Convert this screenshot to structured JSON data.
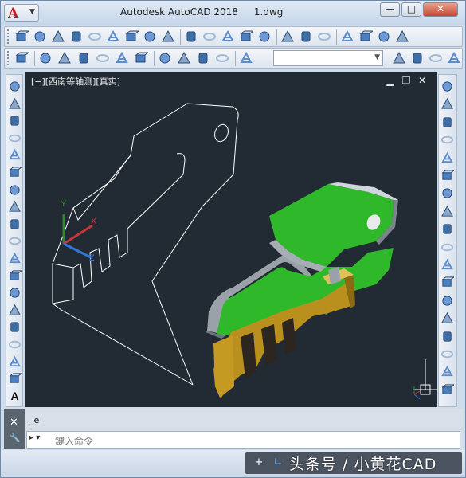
{
  "titlebar": {
    "app_name": "Autodesk AutoCAD 2018",
    "file_name": "1.dwg",
    "app_logo": "A",
    "app_menu_caret": "▼",
    "minimize": "—",
    "maximize": "□",
    "close": "✕"
  },
  "toolbar_modeling": {
    "icons": [
      "polysolid-icon",
      "box-icon",
      "wedge-icon",
      "cone-icon",
      "sphere-icon",
      "cylinder-icon",
      "torus-icon",
      "pyramid-icon",
      "planar-surface-icon",
      "extrude-icon",
      "presspull-icon",
      "sweep-icon",
      "revolve-icon",
      "loft-icon",
      "union-icon",
      "subtract-icon",
      "intersect-icon",
      "move-gizmo-icon",
      "rotate-gizmo-icon",
      "3d-align-icon",
      "3d-array-icon"
    ]
  },
  "toolbar_visual": {
    "icons": [
      "layer-manager-icon",
      "2d-wireframe-icon",
      "3d-wireframe-icon",
      "hidden-icon",
      "realistic-icon",
      "conceptual-icon",
      "shaded-icon",
      "iso-sw-icon",
      "iso-se-icon",
      "iso-ne-icon",
      "iso-nw-icon",
      "camera-icon",
      "navigation-icon",
      "ucs-icon",
      "zoom-window-icon",
      "zoom-extents-icon"
    ],
    "combo_value": ""
  },
  "viewport": {
    "label": "[−][西南等轴测][真实]",
    "minimize": "▁",
    "restore": "❐",
    "close": "✕",
    "ucs_labels": {
      "x": "X",
      "y": "Y",
      "z": "Z"
    }
  },
  "left_toolbar": {
    "icons": [
      "line-icon",
      "construction-line-icon",
      "polyline-icon",
      "polygon-icon",
      "rectangle-icon",
      "arc-icon",
      "circle-icon",
      "revision-cloud-icon",
      "spline-icon",
      "ellipse-icon",
      "ellipse-arc-icon",
      "insert-block-icon",
      "make-block-icon",
      "point-icon",
      "hatch-icon",
      "gradient-icon",
      "region-icon",
      "table-icon",
      "multiline-text-icon"
    ],
    "text_glyph": "A"
  },
  "right_toolbar": {
    "icons": [
      "erase-icon",
      "copy-icon",
      "mirror-icon",
      "offset-icon",
      "array-icon",
      "move-icon",
      "rotate-icon",
      "scale-icon",
      "stretch-icon",
      "trim-icon",
      "extend-icon",
      "break-at-point-icon",
      "break-icon",
      "join-icon",
      "chamfer-icon",
      "fillet-icon",
      "blend-curves-icon",
      "explode-icon"
    ]
  },
  "command": {
    "history": "_e",
    "prompt_placeholder": "鍵入命令",
    "prompt_prefix": "▸ ▾",
    "close_glyph": "✕",
    "settings_glyph": "🔧"
  },
  "status_bar": {
    "watermark": "头条号 / 小黄花CAD",
    "grid_glyph": "+",
    "ortho_glyph": "∟"
  },
  "colors": {
    "viewport_bg": "#222a34",
    "solid_green": "#2fb82a",
    "solid_gold": "#b9901d",
    "wire": "#ffffff"
  }
}
